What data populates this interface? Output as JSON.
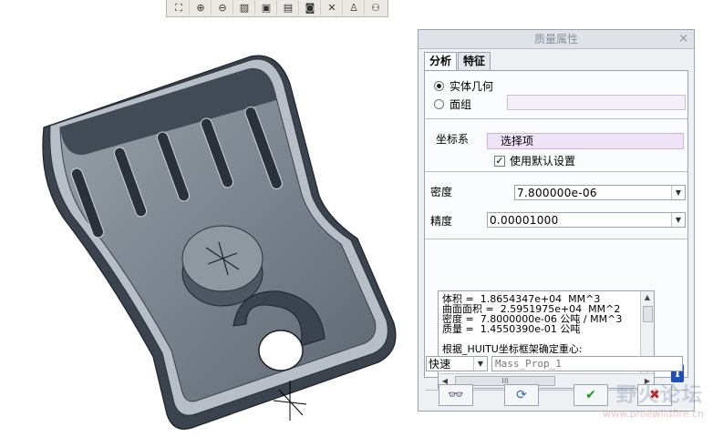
{
  "toolbar": {
    "buttons": [
      {
        "icon": "zoom-fit-icon",
        "glyph": "⛶"
      },
      {
        "icon": "zoom-in-icon",
        "glyph": "⊕"
      },
      {
        "icon": "zoom-out-icon",
        "glyph": "⊖"
      },
      {
        "icon": "repaint-icon",
        "glyph": "▨"
      },
      {
        "icon": "view-orient-icon",
        "glyph": "▣"
      },
      {
        "icon": "saved-views-icon",
        "glyph": "▤"
      },
      {
        "icon": "camera-icon",
        "glyph": "◙"
      },
      {
        "icon": "datum-axis-icon",
        "glyph": "✕"
      },
      {
        "icon": "datum-point-icon",
        "glyph": "♙"
      },
      {
        "icon": "csys-network-icon",
        "glyph": "⚇"
      }
    ]
  },
  "dialog": {
    "title": "质量属性",
    "close_glyph": "×",
    "tabs": [
      {
        "label": "分析",
        "active": true
      },
      {
        "label": "特征",
        "active": false
      }
    ],
    "geometry_options": [
      {
        "label": "实体几何",
        "selected": true
      },
      {
        "label": "面组",
        "selected": false
      }
    ],
    "csys": {
      "label": "坐标系",
      "selector_text": "选择项",
      "use_default_label": "使用默认设置",
      "use_default_checked": true
    },
    "density": {
      "label": "密度",
      "value": "7.800000e-06"
    },
    "accuracy": {
      "label": "精度",
      "value": "0.00001000"
    },
    "results": {
      "lines": [
        "体积 =  1.8654347e+04  MM^3",
        "曲面面积 =  2.5951975e+04  MM^2",
        "密度 =  7.8000000e-06 公吨 / MM^3",
        "质量 =  1.4550390e-01 公吨",
        "",
        "根据_HUITU坐标框架确定重心:"
      ],
      "scroll_thumb_label": "III"
    },
    "mode": {
      "value": "快速"
    },
    "name_field": {
      "value": "Mass_Prop_1"
    },
    "buttons": {
      "preview": "👓",
      "repeat": "⟳",
      "ok": "✔",
      "cancel": "✖"
    }
  },
  "watermark": {
    "title": "野火论坛",
    "url": "www.proewildfire.cn"
  },
  "colors": {
    "part_face": "#6e7884",
    "part_top": "#8c959f",
    "part_dark": "#2e3640",
    "ok_green": "#1a9a1a",
    "cancel_red": "#c81e1e"
  }
}
